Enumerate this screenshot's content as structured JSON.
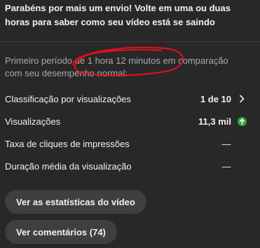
{
  "header": {
    "message": "Parabéns por mais um envio! Volte em uma ou duas horas para saber como seu vídeo está se saindo"
  },
  "period": {
    "text": "Primeiro período de 1 hora 12 minutos em comparação com seu desempenho normal:"
  },
  "metrics": [
    {
      "label": "Classificação por visualizações",
      "value": "1 de 10",
      "trail_icon": "chevron-right-icon"
    },
    {
      "label": "Visualizações",
      "value": "11,3 mil",
      "trail_icon": "arrow-up-circle-icon"
    },
    {
      "label": "Taxa de cliques de impressões",
      "value": "—"
    },
    {
      "label": "Duração média da visualização",
      "value": "—"
    }
  ],
  "buttons": {
    "stats_label": "Ver as estatísticas do vídeo",
    "comments_label": "Ver comentários (74)"
  },
  "colors": {
    "background": "#282828",
    "button_bg": "#3f3f3f",
    "muted_text": "#aaaaaa",
    "up_indicator": "#2ba640",
    "annotation": "#e0121b"
  }
}
